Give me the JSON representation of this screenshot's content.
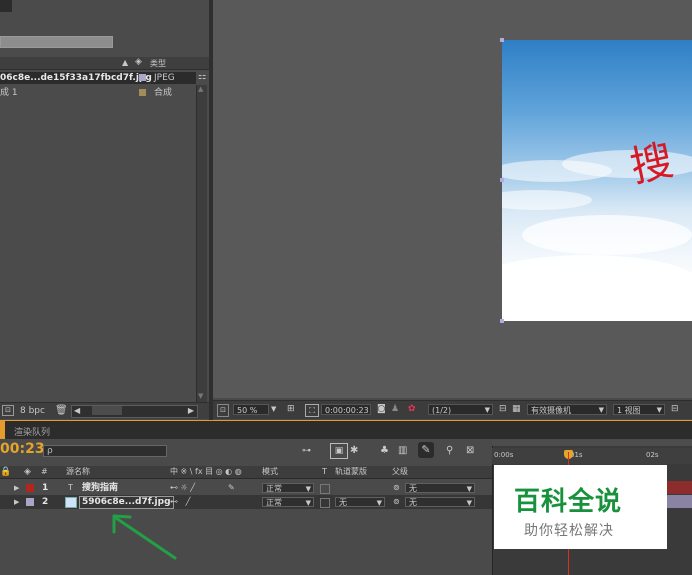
{
  "project": {
    "col_type": "类型",
    "items": [
      {
        "name": "06c8e...de15f33a17fbcd7f.jpg",
        "type": "JPEG",
        "swatch": "#aba7ca"
      },
      {
        "name": "成 1",
        "type": "合成",
        "swatch": "#a48b5a"
      }
    ],
    "bpc": "8 bpc"
  },
  "viewer": {
    "zoom": "50 %",
    "timecode": "0:00:00:23",
    "resolution": "(1/2)",
    "camera": "有效摄像机",
    "views": "1 视图",
    "comp_text": "搜"
  },
  "timeline": {
    "tab_label": "渲染队列",
    "timecode": "00:23",
    "search_placeholder": "ρ",
    "col_hash": "#",
    "col_source": "源名称",
    "col_switches": "中 ※ \\ fx 目 ◎ ◐ ◍",
    "col_mode": "模式",
    "col_t": "T",
    "col_trkmat": "轨道蒙版",
    "col_parent": "父级",
    "ruler": [
      "0:00s",
      "01s",
      "02s"
    ],
    "layers": [
      {
        "index": "1",
        "name": "搜狗指南",
        "mode": "正常",
        "trkmat": "",
        "parent": "无",
        "label_color": "#b5251f"
      },
      {
        "index": "2",
        "name": "5906c8e...d7f.jpg",
        "mode": "正常",
        "trkmat": "无",
        "parent": "无",
        "label_color": "#a9a5c6"
      }
    ]
  },
  "watermark": {
    "title": "百科全说",
    "subtitle": "助你轻松解决"
  },
  "colors": {
    "accent_orange": "#e5a42a",
    "playhead": "#d6331b",
    "arrow": "#22a046"
  }
}
